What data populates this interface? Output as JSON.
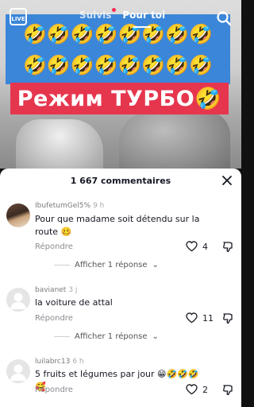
{
  "top_nav": {
    "live_label": "LIVE",
    "tabs": [
      {
        "label": "Suivis"
      },
      {
        "label": "Pour toi"
      }
    ]
  },
  "video": {
    "emoji_rows": [
      "🤣🤣🤣🤣🤣🤣🤣🤣",
      "🤣🤣🤣🤣🤣🤣🤣🤣"
    ],
    "banner_text": "Режим ТУРБО🤣"
  },
  "comments_sheet": {
    "title": "1 667 commentaires",
    "comments": [
      {
        "username": "IbufetumGel5%",
        "time": "9 h",
        "text": "Pour que madame soit détendu sur la route 🥴",
        "reply_label": "Répondre",
        "likes": "4",
        "more_replies": "Afficher 1 réponse"
      },
      {
        "username": "bavianet",
        "time": "3 j",
        "text": "la voiture de attal",
        "reply_label": "Répondre",
        "likes": "11",
        "more_replies": "Afficher 1 réponse"
      },
      {
        "username": "luilabrc13",
        "time": "6 h",
        "text": "5 fruits et légumes par jour 😁🤣🤣🤣🥰",
        "reply_label": "Répondre",
        "likes": "2"
      }
    ]
  },
  "colors": {
    "banner_red": "#e6364e",
    "emoji_band_blue": "#3b86d9",
    "tiktok_red": "#fe2c55"
  }
}
